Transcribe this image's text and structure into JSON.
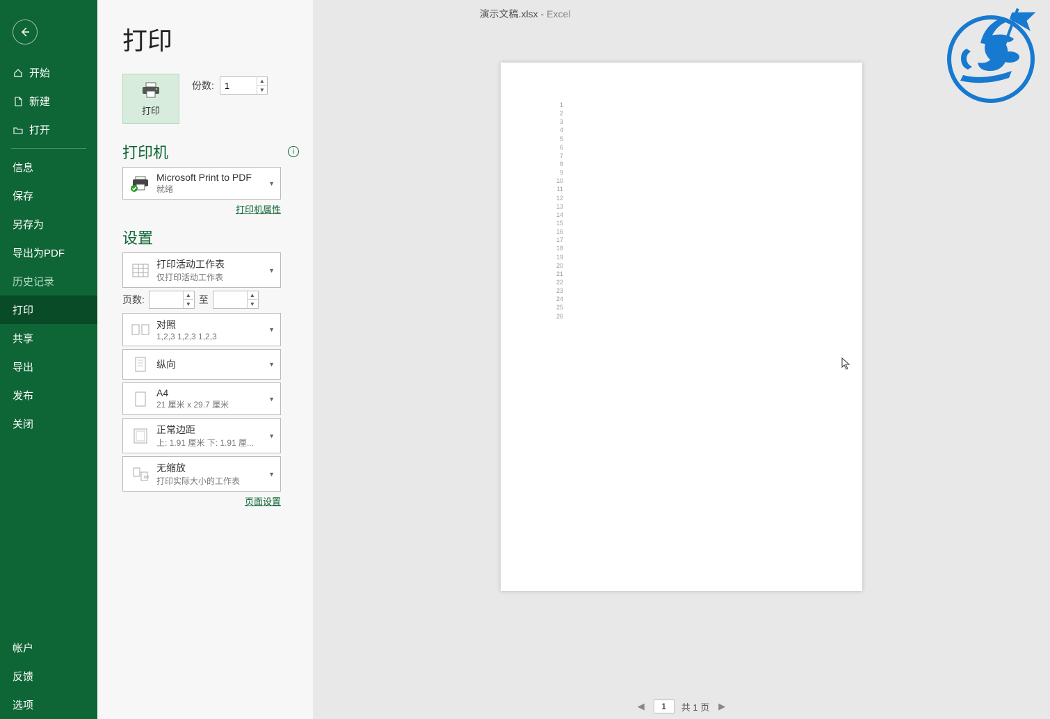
{
  "titlebar": {
    "filename": "演示文稿.xlsx",
    "sep": " - ",
    "app": "Excel"
  },
  "sidebar": {
    "items": [
      {
        "key": "home",
        "label": "开始",
        "icon": "home-icon"
      },
      {
        "key": "new",
        "label": "新建",
        "icon": "file-icon"
      },
      {
        "key": "open",
        "label": "打开",
        "icon": "folder-icon"
      },
      {
        "key": "info",
        "label": "信息"
      },
      {
        "key": "save",
        "label": "保存"
      },
      {
        "key": "saveas",
        "label": "另存为"
      },
      {
        "key": "exportpdf",
        "label": "导出为PDF"
      },
      {
        "key": "history",
        "label": "历史记录",
        "dim": true
      },
      {
        "key": "print",
        "label": "打印",
        "active": true
      },
      {
        "key": "share",
        "label": "共享"
      },
      {
        "key": "export",
        "label": "导出"
      },
      {
        "key": "publish",
        "label": "发布"
      },
      {
        "key": "close",
        "label": "关闭"
      }
    ],
    "bottom": [
      {
        "key": "account",
        "label": "帐户"
      },
      {
        "key": "feedback",
        "label": "反馈"
      },
      {
        "key": "options",
        "label": "选项"
      }
    ]
  },
  "page": {
    "title": "打印",
    "print_button": "打印",
    "copies_label": "份数:",
    "copies_value": "1"
  },
  "printer": {
    "section_title": "打印机",
    "name": "Microsoft Print to PDF",
    "status": "就绪",
    "properties_link": "打印机属性"
  },
  "settings": {
    "section_title": "设置",
    "what": {
      "title": "打印活动工作表",
      "sub": "仅打印活动工作表"
    },
    "pages": {
      "label": "页数:",
      "to": "至"
    },
    "collate": {
      "title": "对照",
      "sub": "1,2,3   1,2,3   1,2,3"
    },
    "orientation": {
      "title": "纵向"
    },
    "paper": {
      "title": "A4",
      "sub": "21 厘米 x 29.7 厘米"
    },
    "margins": {
      "title": "正常边距",
      "sub": "上: 1.91 厘米 下: 1.91 厘..."
    },
    "scaling": {
      "title": "无缩放",
      "sub": "打印实际大小的工作表"
    },
    "page_setup_link": "页面设置"
  },
  "preview": {
    "rows": [
      "1",
      "2",
      "3",
      "4",
      "5",
      "6",
      "7",
      "8",
      "9",
      "10",
      "11",
      "12",
      "13",
      "14",
      "15",
      "16",
      "17",
      "18",
      "19",
      "20",
      "21",
      "22",
      "23",
      "24",
      "25",
      "26"
    ],
    "current_page": "1",
    "page_info": "共 1 页"
  }
}
